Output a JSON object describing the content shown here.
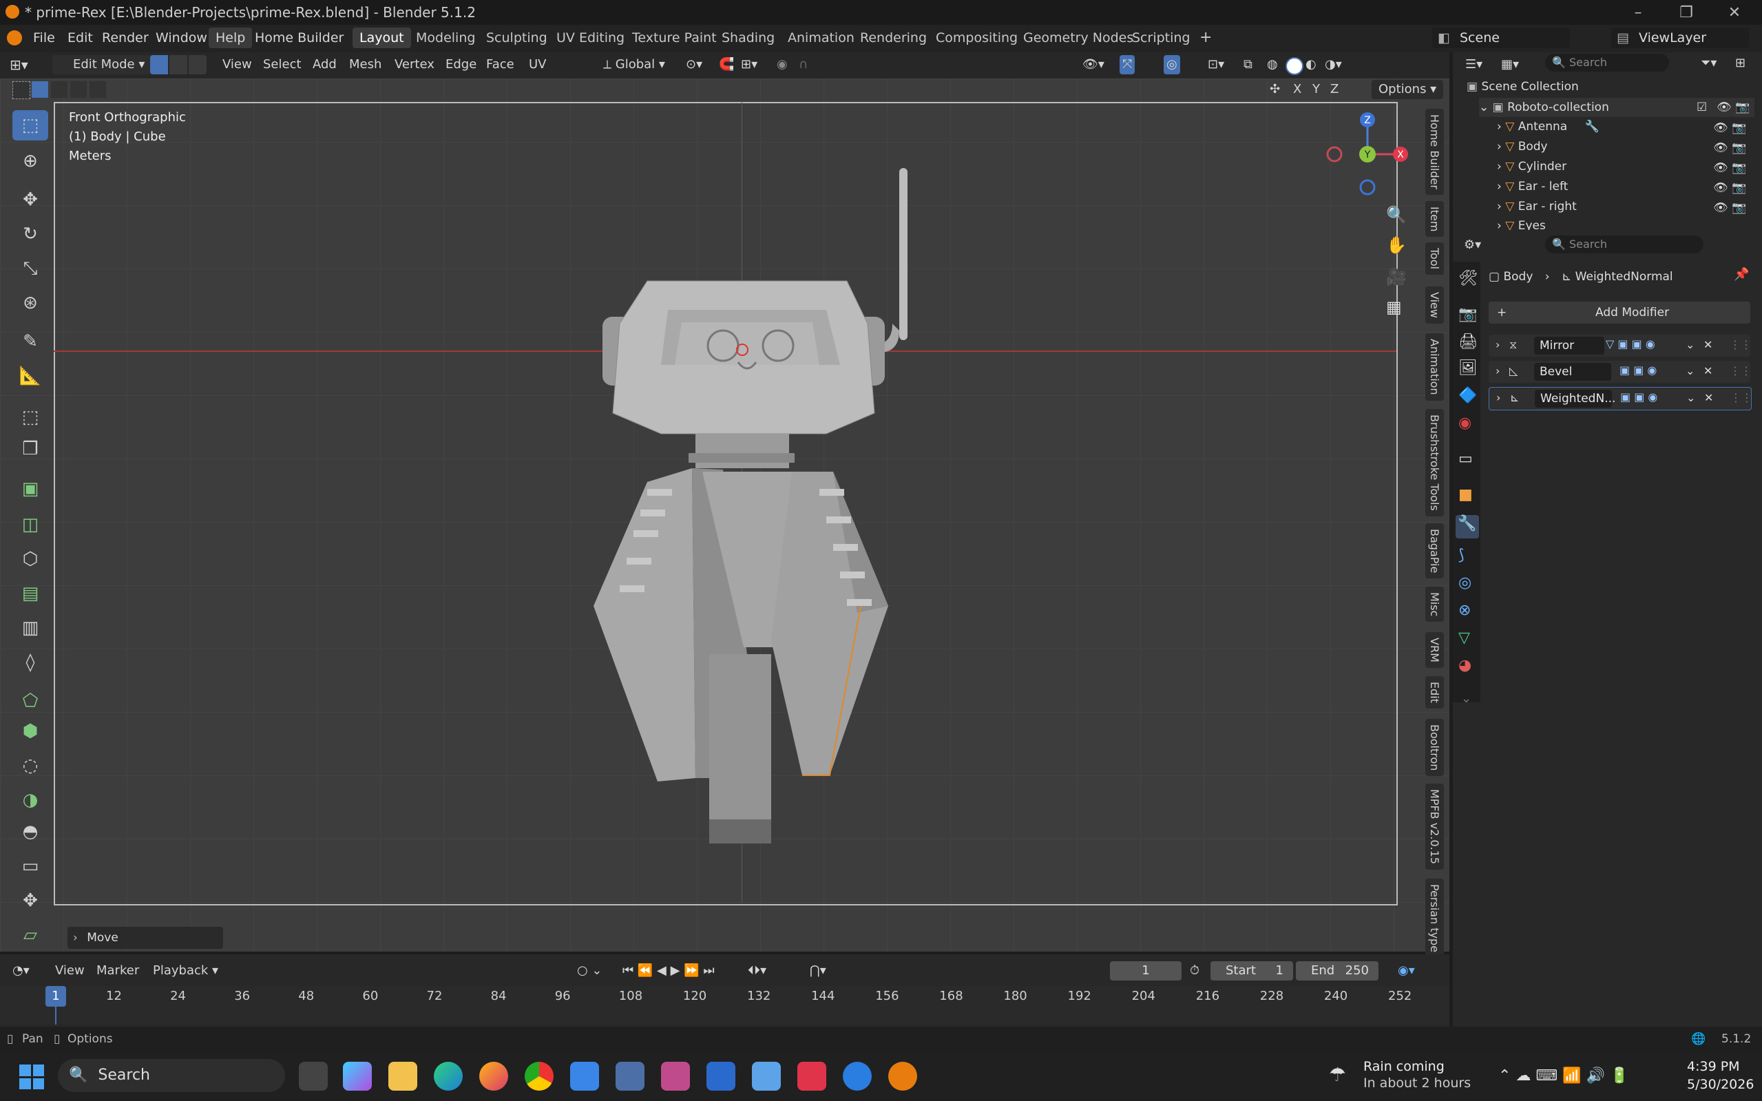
{
  "window": {
    "title": "* prime-Rex [E:\\Blender-Projects\\prime-Rex.blend] - Blender 5.1.2"
  },
  "menu": [
    "File",
    "Edit",
    "Render",
    "Window",
    "Help",
    "Home Builder"
  ],
  "workspaces": [
    "Layout",
    "Modeling",
    "Sculpting",
    "UV Editing",
    "Texture Paint",
    "Shading",
    "Animation",
    "Rendering",
    "Compositing",
    "Geometry Nodes",
    "Scripting"
  ],
  "scene": {
    "label": "Scene",
    "viewlayer": "ViewLayer"
  },
  "header": {
    "mode": "Edit Mode",
    "menus": [
      "View",
      "Select",
      "Add",
      "Mesh",
      "Vertex",
      "Edge",
      "Face",
      "UV"
    ],
    "orientation": "Global",
    "options": "Options",
    "axes": [
      "X",
      "Y",
      "Z"
    ]
  },
  "viewport": {
    "view_name": "Front Orthographic",
    "object_info": "(1) Body | Cube",
    "units": "Meters",
    "last_op": "Move",
    "side_tabs": [
      "Home Builder",
      "Item",
      "Tool",
      "View",
      "Animation",
      "Brushstroke Tools",
      "BagaPie",
      "Misc",
      "VRM",
      "Edit",
      "Booltron",
      "MPFB v2.0.15",
      "Persian type"
    ]
  },
  "gizmo": {
    "z": "Z",
    "y": "Y",
    "x": "X"
  },
  "outliner": {
    "search_placeholder": "Search",
    "root": "Scene Collection",
    "collection": "Roboto-collection",
    "items": [
      "Antenna",
      "Body",
      "Cylinder",
      "Ear - left",
      "Ear - right",
      "Eyes"
    ]
  },
  "properties": {
    "search_placeholder": "Search",
    "object": "Body",
    "modifier": "WeightedNormal",
    "add_modifier": "Add Modifier",
    "modifiers": [
      "Mirror",
      "Bevel",
      "WeightedN..."
    ]
  },
  "timeline": {
    "menus": [
      "View",
      "Marker",
      "Playback"
    ],
    "current_frame": "1",
    "start_label": "Start",
    "start": "1",
    "end_label": "End",
    "end": "250",
    "ticks": [
      "1",
      "12",
      "24",
      "36",
      "48",
      "60",
      "72",
      "84",
      "96",
      "108",
      "120",
      "132",
      "144",
      "156",
      "168",
      "180",
      "192",
      "204",
      "216",
      "228",
      "240",
      "252"
    ]
  },
  "status": {
    "left1": "Pan",
    "left2": "Options",
    "version": "5.1.2"
  },
  "taskbar": {
    "search": "Search",
    "weather_title": "Rain coming",
    "weather_sub": "In about 2 hours",
    "time": "4:39 PM",
    "date": "5/30/2026"
  }
}
